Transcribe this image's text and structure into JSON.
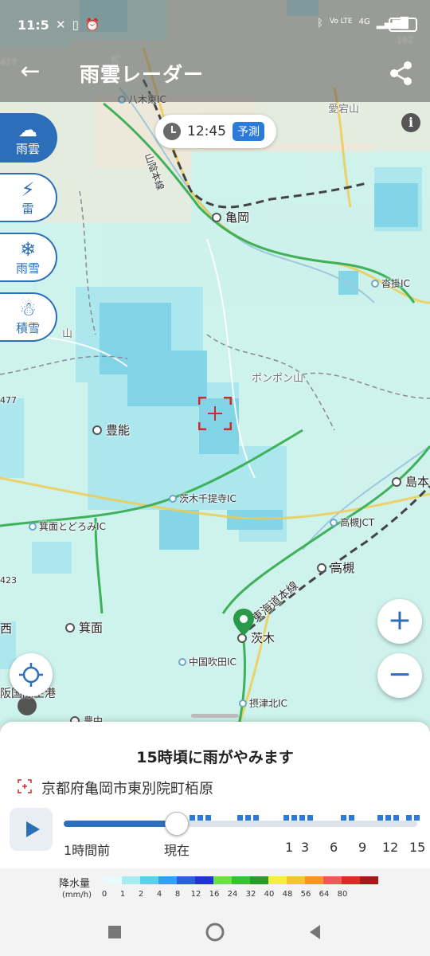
{
  "status_bar": {
    "time": "11:5",
    "battery": "81",
    "net": "4G",
    "volte": "Vo LTE"
  },
  "header": {
    "title": "雨雲レーダー",
    "back": "←"
  },
  "time_pill": {
    "time": "12:45",
    "tag": "予測"
  },
  "info": "i",
  "layers": [
    {
      "glyph": "☁",
      "label": "雨雲",
      "icon": "cloud-rain-icon"
    },
    {
      "glyph": "⚡",
      "label": "雷",
      "icon": "lightning-icon"
    },
    {
      "glyph": "❄",
      "label": "雨雪",
      "icon": "snow-rain-icon"
    },
    {
      "glyph": "☃",
      "label": "積雪",
      "icon": "snowman-icon"
    }
  ],
  "map": {
    "places": {
      "kameoka": "亀岡",
      "toyono": "豊能",
      "minoh": "箕面",
      "ibaraki": "茨木",
      "takatsuki": "高槻",
      "shimamoto": "島本",
      "nishi": "西"
    },
    "ics": {
      "yagi_higashi": "八木東IC",
      "ic_top": "IC",
      "kutsukake": "沓掛IC",
      "ibaraki_senteiji": "茨木千提寺IC",
      "mino_todoromi": "箕面とどろみIC",
      "takatsuki_jct": "高槻JCT",
      "chugoku_suita": "中国吹田IC",
      "settsu_kita": "摂津北IC"
    },
    "mountains": {
      "atago": "愛宕山",
      "ponpon": "ポンポン山",
      "yama": "山"
    },
    "rail": {
      "sanin": "山陰本線",
      "tokaido": "東海道本線"
    },
    "misc": {
      "airport": "阪国際空港",
      "toyonaka": "豊中",
      "route477a": "477",
      "route477b": "477",
      "route162": "162",
      "route423": "423"
    }
  },
  "zoom": {
    "in": "+",
    "out": "−"
  },
  "panel": {
    "message": "15時頃に雨がやみます",
    "location": "京都府亀岡市東別院町栢原",
    "timeline_labels": [
      {
        "key": "before",
        "text": "1時間前"
      },
      {
        "key": "now",
        "text": "現在"
      },
      {
        "key": "h1",
        "text": "1"
      },
      {
        "key": "h3",
        "text": "3"
      },
      {
        "key": "h6",
        "text": "6"
      },
      {
        "key": "h9",
        "text": "9"
      },
      {
        "key": "h12",
        "text": "12"
      },
      {
        "key": "h15",
        "text": "15"
      }
    ],
    "progress_fraction": 0.32
  },
  "legend": {
    "title": "降水量",
    "unit": "(mm/h)",
    "values": [
      "0",
      "1",
      "2",
      "4",
      "8",
      "12",
      "16",
      "24",
      "32",
      "40",
      "48",
      "56",
      "64",
      "80"
    ],
    "colors": [
      "#e8fafa",
      "#a6ecf0",
      "#5fcfe9",
      "#3a9ef0",
      "#2b5fe0",
      "#2233d6",
      "#6be04a",
      "#3cbf33",
      "#2a9a2a",
      "#f4ef3a",
      "#f5c52c",
      "#f2962a",
      "#ee5a5a",
      "#e02a2a",
      "#a51919"
    ]
  }
}
